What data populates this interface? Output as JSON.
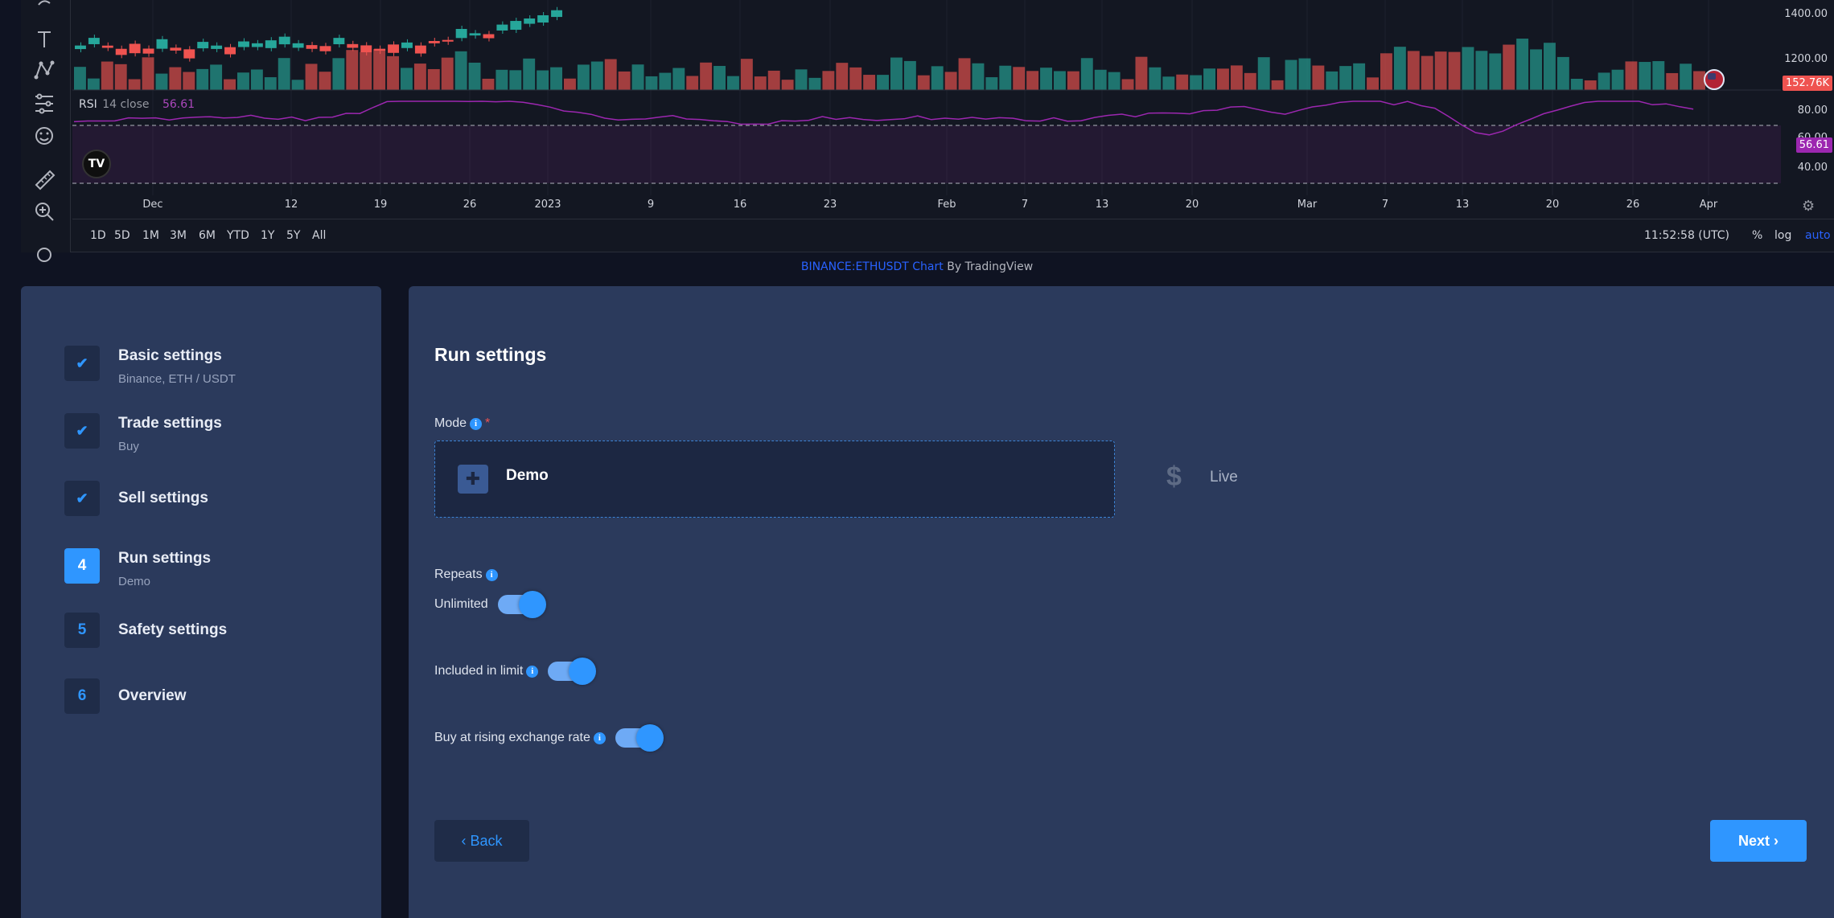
{
  "chart": {
    "price_axis_labels": [
      "1400.00",
      "1200.00"
    ],
    "volume_tag": "152.76K",
    "rsi_axis_labels": [
      "80.00",
      "40.00"
    ],
    "rsi_partial_label": "60.00",
    "rsi_value_tag": "56.61",
    "rsi_name": "RSI",
    "rsi_params": "14 close",
    "rsi_value": "56.61",
    "logo": "TV",
    "time_ticks": [
      "Dec",
      "12",
      "19",
      "26",
      "2023",
      "9",
      "16",
      "23",
      "Feb",
      "7",
      "13",
      "20",
      "Mar",
      "7",
      "13",
      "20",
      "26",
      "Apr"
    ],
    "ranges": [
      "1D",
      "5D",
      "1M",
      "3M",
      "6M",
      "YTD",
      "1Y",
      "5Y",
      "All"
    ],
    "clock": "11:52:58 (UTC)",
    "axis_options": [
      "%",
      "log",
      "auto"
    ],
    "colors": {
      "up": "#26a69a",
      "down": "#ef5350",
      "rsi": "#9c27b0",
      "volume_tag": "#ef5350",
      "rsi_tag": "#9c27b0"
    }
  },
  "attribution": {
    "symbol": "BINANCE:ETHUSDT Chart",
    "suffix": " By TradingView"
  },
  "steps": [
    {
      "marker": "check",
      "title": "Basic settings",
      "subtitle": "Binance, ETH / USDT"
    },
    {
      "marker": "check",
      "title": "Trade settings",
      "subtitle": "Buy"
    },
    {
      "marker": "check",
      "title": "Sell settings",
      "subtitle": ""
    },
    {
      "marker": "4",
      "title": "Run settings",
      "subtitle": "Demo"
    },
    {
      "marker": "5",
      "title": "Safety settings",
      "subtitle": ""
    },
    {
      "marker": "6",
      "title": "Overview",
      "subtitle": ""
    }
  ],
  "form": {
    "title": "Run settings",
    "mode_label": "Mode",
    "required": "*",
    "modes": {
      "demo": "Demo",
      "live": "Live",
      "selected": "Demo"
    },
    "repeats_label": "Repeats",
    "toggles": [
      {
        "label": "Unlimited",
        "on": true
      },
      {
        "label": "Included in limit",
        "on": true
      },
      {
        "label": "Buy at rising exchange rate",
        "on": true
      }
    ],
    "back_label": "Back",
    "next_label": "Next"
  }
}
